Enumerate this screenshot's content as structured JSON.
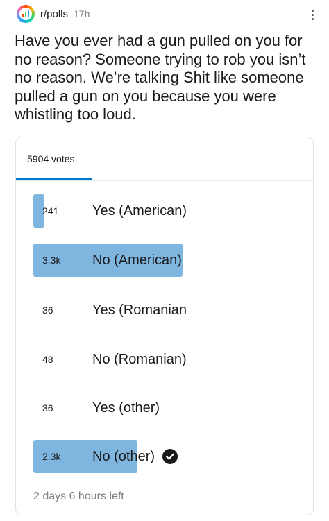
{
  "post": {
    "subreddit": "r/polls",
    "age": "17h",
    "title": "Have you ever had a gun pulled on you for no reason? Someone trying to rob you isn’t no reason. We’re talking Shit like someone pulled a gun on you because you were whistling too loud."
  },
  "poll": {
    "total_votes": "5904 votes",
    "time_left": "2 days 6 hours left",
    "options": [
      {
        "count": "241",
        "label": "Yes (American)",
        "share": 0.041,
        "selected": false
      },
      {
        "count": "3.3k",
        "label": "No (American)",
        "share": 0.559,
        "selected": false
      },
      {
        "count": "36",
        "label": "Yes (Romanian",
        "share": 0.006,
        "selected": false
      },
      {
        "count": "48",
        "label": "No (Romanian)",
        "share": 0.008,
        "selected": false
      },
      {
        "count": "36",
        "label": "Yes (other)",
        "share": 0.006,
        "selected": false
      },
      {
        "count": "2.3k",
        "label": "No (other)",
        "share": 0.39,
        "selected": true
      }
    ]
  },
  "colors": {
    "bar": "#7fb6e0",
    "accent": "#0079d3",
    "muted_text": "#787c7e"
  },
  "icons": {
    "avatar": "polls-chart-icon",
    "menu": "more-vertical-icon",
    "selected": "checkmark-circle-icon"
  }
}
